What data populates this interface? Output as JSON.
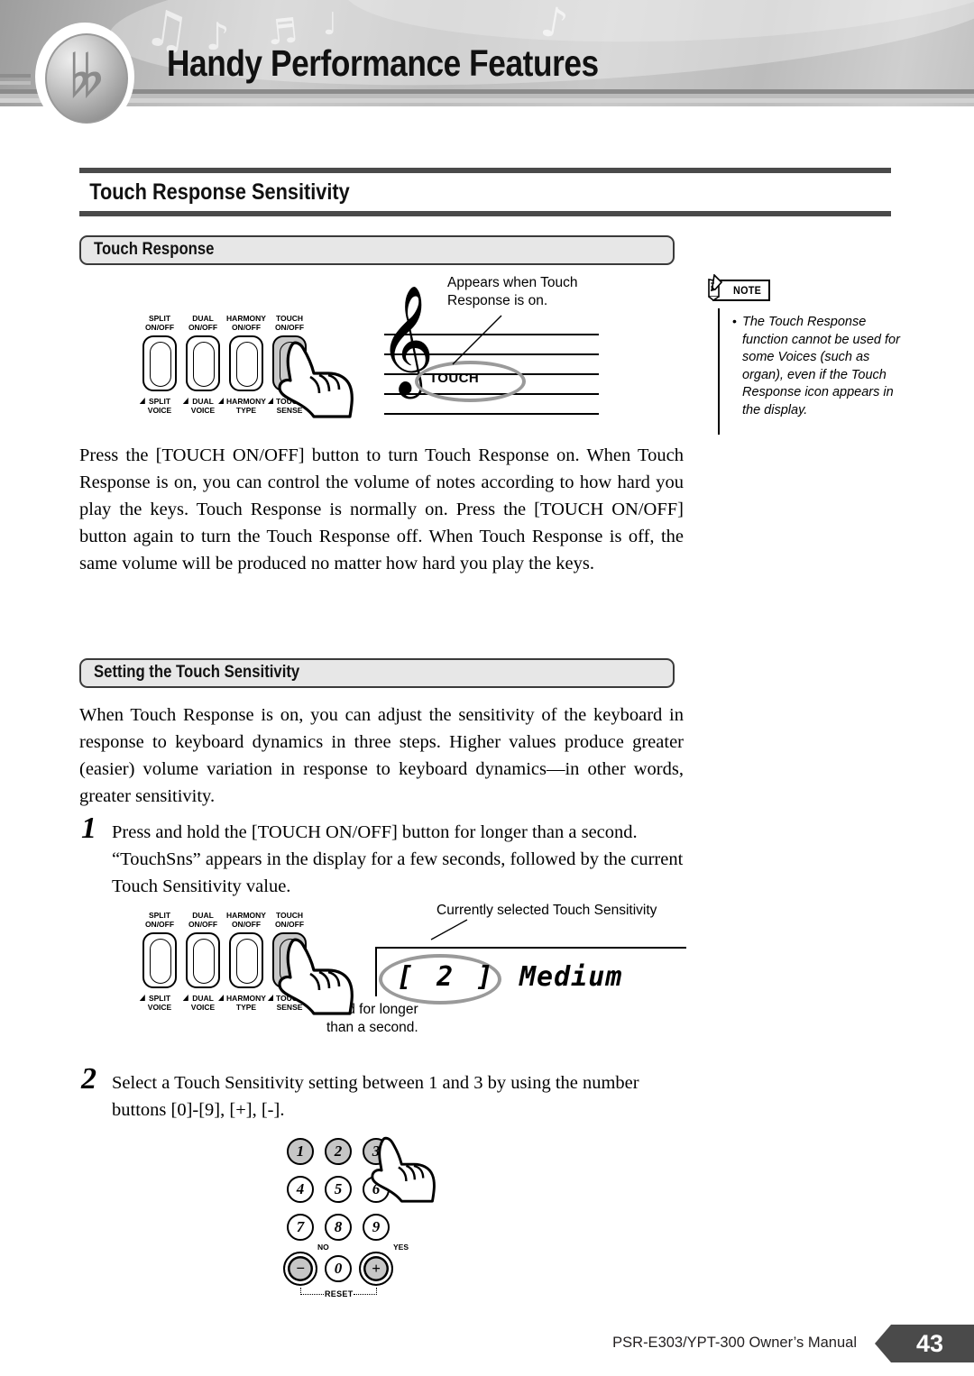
{
  "header": {
    "title": "Handy Performance Features",
    "logo_icon": "bass-clef-logo",
    "decorations": [
      "music-note-eighth",
      "music-note-beamed",
      "music-note-quarter",
      "music-rest",
      "music-note-dotted"
    ]
  },
  "page_title": "Touch Response Sensitivity",
  "sections": [
    {
      "id": "touch-response",
      "heading": "Touch Response",
      "body": "Press the [TOUCH ON/OFF] button to turn Touch Response on. When Touch Response is on, you can control the volume of notes according to how hard you play the keys. Touch Response is normally on. Press the [TOUCH ON/OFF] button again to turn the Touch Response off. When Touch Response is off, the same volume will be produced no matter how hard you play the keys."
    },
    {
      "id": "setting-the-touch-sensitivity",
      "heading": "Setting the Touch Sensitivity",
      "body": "When Touch Response is on, you can adjust the sensitivity of the keyboard in response to keyboard dynamics in three steps. Higher values produce greater (easier) volume variation in response to keyboard dynamics—in other words, greater sensitivity."
    }
  ],
  "panel": {
    "buttons": [
      {
        "top": "SPLIT\nON/OFF",
        "top_line1": "SPLIT",
        "top_line2": "ON/OFF",
        "bot_line1": "SPLIT",
        "bot_line2": "VOICE",
        "active": false
      },
      {
        "top_line1": "DUAL",
        "top_line2": "ON/OFF",
        "bot_line1": "DUAL",
        "bot_line2": "VOICE",
        "active": false
      },
      {
        "top_line1": "HARMONY",
        "top_line2": "ON/OFF",
        "bot_line1": "HARMONY",
        "bot_line2": "TYPE",
        "active": false
      },
      {
        "top_line1": "TOUCH",
        "top_line2": "ON/OFF",
        "bot_line1": "TOUCH",
        "bot_line2": "SENSE",
        "active": true
      }
    ]
  },
  "staff_callout": {
    "text_line1": "Appears when Touch",
    "text_line2": "Response is on.",
    "icon_label": "TOUCH",
    "clef_icon": "treble-clef"
  },
  "note_box": {
    "tag": "NOTE",
    "icon": "pencil-note-icon",
    "bullet": "•",
    "text": "The Touch Response function cannot be used for some Voices (such as organ), even if the Touch Response icon appears in the display."
  },
  "steps": [
    {
      "number": "1",
      "text": "Press and hold the [TOUCH ON/OFF] button for longer than a second. “TouchSns” appears in the display for a few seconds, followed by the current Touch Sensitivity value."
    },
    {
      "number": "2",
      "text": "Select a Touch Sensitivity setting between 1 and 3 by using the number buttons [0]-[9], [+], [-]."
    }
  ],
  "lcd": {
    "callout": "Currently selected Touch Sensitivity",
    "value_bracket": "[   2 ]",
    "value_number": "2",
    "value_name": "Medium",
    "hold_line1": "Hold for longer",
    "hold_line2": "than a second."
  },
  "keypad": {
    "keys": [
      {
        "label": "1",
        "gray": true
      },
      {
        "label": "2",
        "gray": true
      },
      {
        "label": "3",
        "gray": true
      },
      {
        "label": "4",
        "gray": false
      },
      {
        "label": "5",
        "gray": false
      },
      {
        "label": "6",
        "gray": false
      },
      {
        "label": "7",
        "gray": false
      },
      {
        "label": "8",
        "gray": false
      },
      {
        "label": "9",
        "gray": false
      }
    ],
    "minus_label": "−",
    "zero_label": "0",
    "plus_label": "+",
    "no_label": "NO",
    "yes_label": "YES",
    "reset_label": "RESET"
  },
  "footer": {
    "text": "PSR-E303/YPT-300  Owner’s Manual",
    "page": "43"
  },
  "colors": {
    "banner_gray": "#c2c2c2",
    "rule_dark": "#4a4a4a",
    "section_fill": "#e7e7e7",
    "button_active": "#c9c9c9",
    "ellipse_gray": "#9a9a9a",
    "footer_tab": "#4a4a4a"
  }
}
